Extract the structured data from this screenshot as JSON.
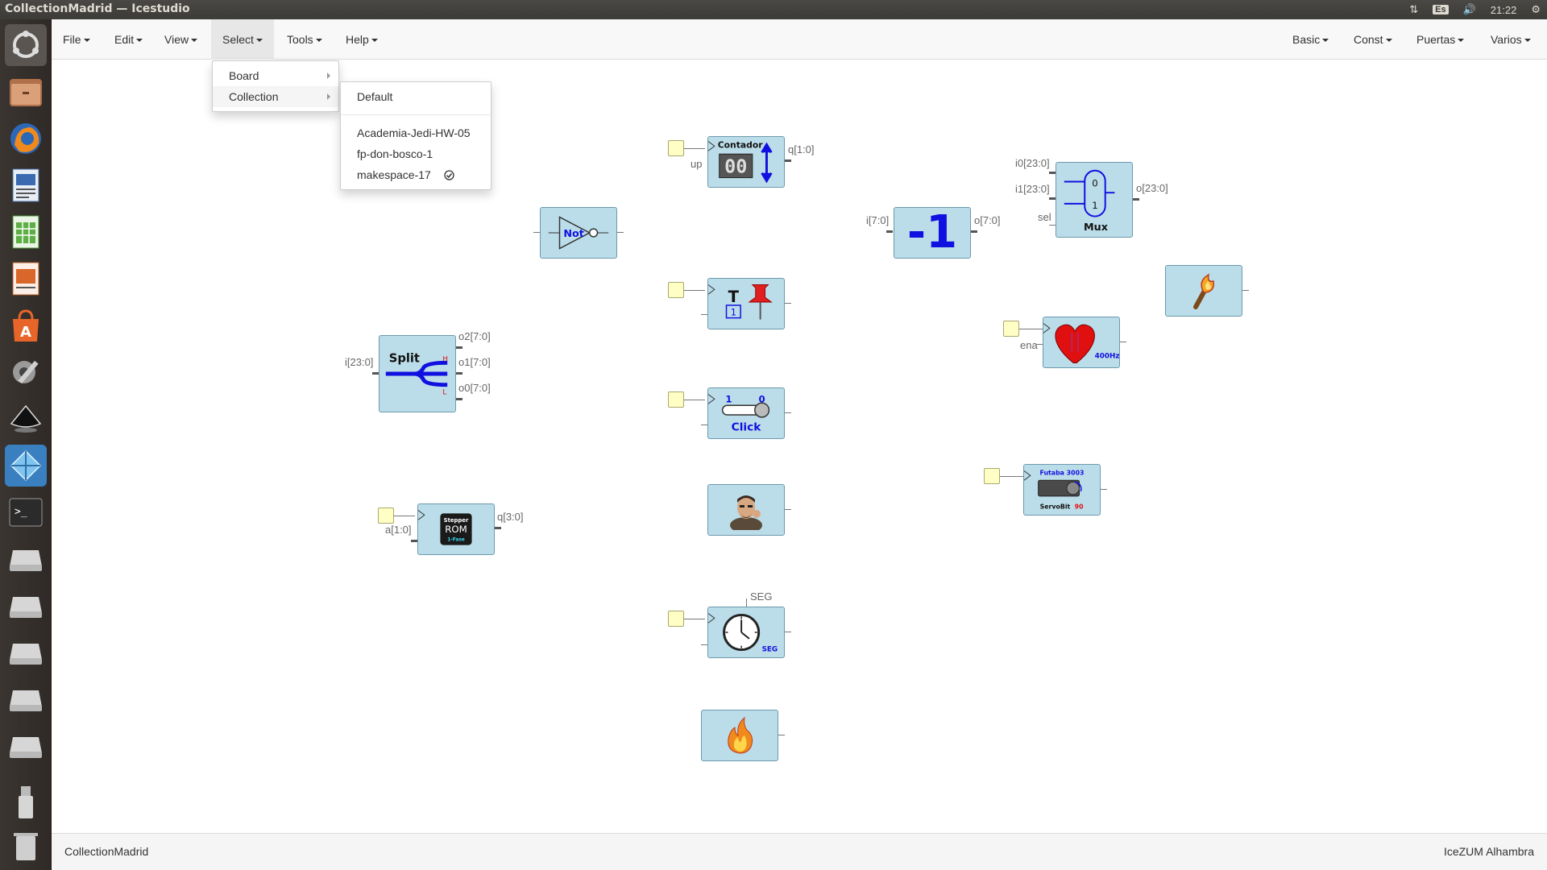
{
  "window": {
    "title": "CollectionMadrid — Icestudio",
    "clock": "21:22",
    "keyboard_layout": "Es"
  },
  "launcher": {
    "items": [
      {
        "name": "dash-icon"
      },
      {
        "name": "files-icon"
      },
      {
        "name": "firefox-icon"
      },
      {
        "name": "writer-icon"
      },
      {
        "name": "calc-icon"
      },
      {
        "name": "impress-icon"
      },
      {
        "name": "software-center-icon"
      },
      {
        "name": "system-settings-icon"
      },
      {
        "name": "inkscape-icon"
      },
      {
        "name": "icestudio-icon"
      },
      {
        "name": "terminal-icon"
      },
      {
        "name": "drive-icon"
      },
      {
        "name": "drive-icon"
      },
      {
        "name": "drive-icon"
      },
      {
        "name": "drive-icon"
      },
      {
        "name": "drive-icon"
      },
      {
        "name": "usb-icon"
      },
      {
        "name": "trash-icon"
      }
    ]
  },
  "menubar": {
    "left": [
      "File",
      "Edit",
      "View",
      "Select",
      "Tools",
      "Help"
    ],
    "right": [
      "Basic",
      "Const",
      "Puertas",
      "Varios"
    ]
  },
  "select_menu": {
    "items": [
      {
        "label": "Board"
      },
      {
        "label": "Collection"
      }
    ]
  },
  "collection_submenu": {
    "default_label": "Default",
    "items": [
      {
        "label": "Academia-Jedi-HW-05"
      },
      {
        "label": "fp-don-bosco-1"
      },
      {
        "label": "makespace-17"
      }
    ]
  },
  "canvas": {
    "blocks": {
      "contador": {
        "title": "Contador",
        "digits": "00",
        "in_label": "up",
        "out_label": "q[1:0]"
      },
      "not": {
        "title": "Not"
      },
      "minus_one": {
        "text": "-1",
        "in_label": "i[7:0]",
        "out_label": "o[7:0]"
      },
      "mux": {
        "title": "Mux",
        "in0_label": "i0[23:0]",
        "in1_label": "i1[23:0]",
        "sel_label": "sel",
        "out_label": "o[23:0]",
        "bit0": "0",
        "bit1": "1"
      },
      "toggle": {
        "title": "T",
        "sub": "1"
      },
      "heartbeat": {
        "freq": "400Hz",
        "in_label": "ena"
      },
      "split": {
        "title": "Split",
        "in_label": "i[23:0]",
        "out2": "o2[7:0]",
        "out1": "o1[7:0]",
        "out0": "o0[7:0]",
        "h": "H",
        "l": "L"
      },
      "click": {
        "title": "Click",
        "one": "1",
        "zero": "0"
      },
      "stepper": {
        "line1": "Stepper",
        "line2": "ROM",
        "line3": "1-Fase",
        "in_label": "a[1:0]",
        "out_label": "q[3:0]"
      },
      "servo": {
        "line1": "Futaba 3003",
        "line2": "ServoBit",
        "angle": "90"
      },
      "timer": {
        "param_label": "SEG",
        "unit": "SEG"
      }
    }
  },
  "statusbar": {
    "left": "CollectionMadrid",
    "right": "IceZUM Alhambra"
  }
}
